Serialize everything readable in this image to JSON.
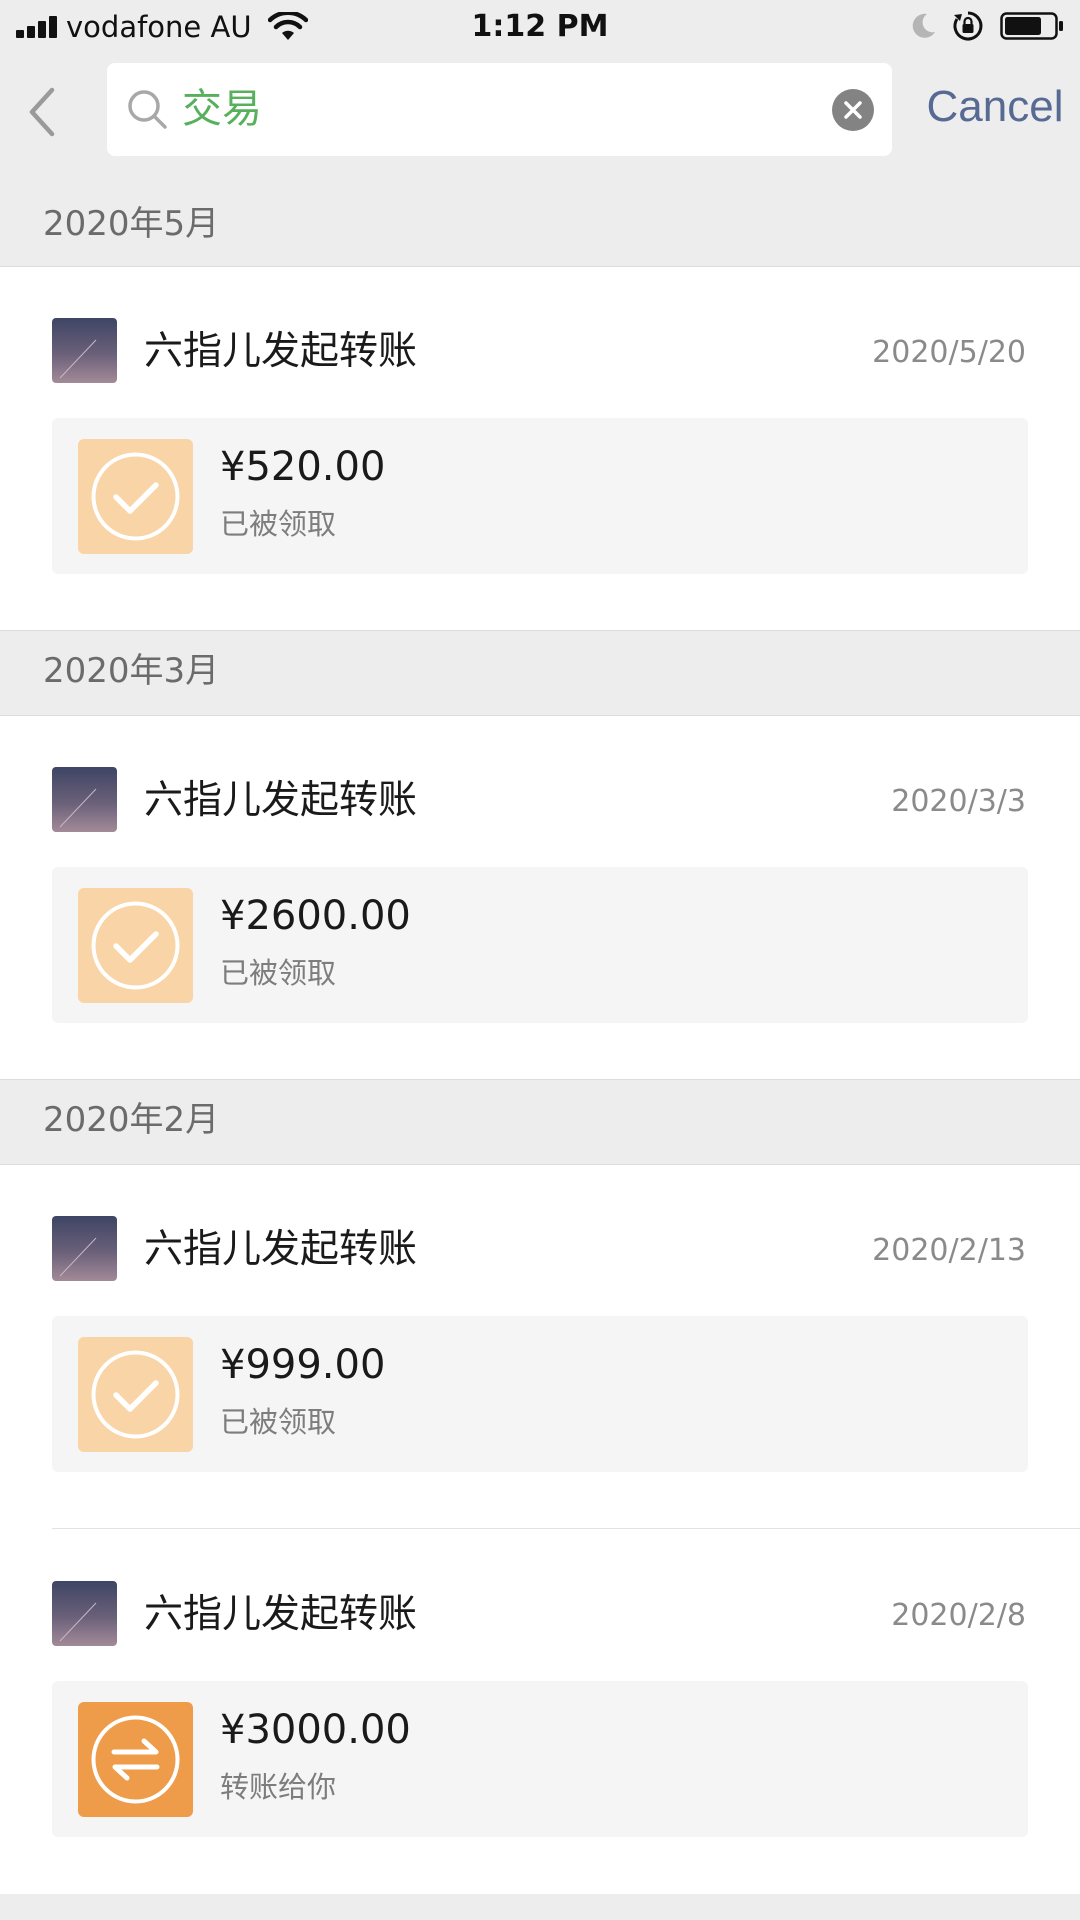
{
  "status_bar": {
    "carrier": "vodafone AU",
    "time": "1:12 PM",
    "signal_icon": "signal-bars-icon",
    "wifi_icon": "wifi-icon",
    "moon_icon": "do-not-disturb-moon-icon",
    "lock_icon": "orientation-lock-icon",
    "battery_icon": "battery-icon",
    "battery_level": 0.75
  },
  "search": {
    "back_icon": "chevron-left-icon",
    "search_icon": "search-icon",
    "query": "交易",
    "clear_icon": "clear-circle-icon",
    "cancel_label": "Cancel"
  },
  "sections": [
    {
      "month": "2020年5月",
      "entries": [
        {
          "title": "六指儿发起转账",
          "date": "2020/5/20",
          "amount": "¥520.00",
          "status": "已被领取",
          "icon": "check-circle-icon",
          "icon_color": "#f8d4a6"
        }
      ]
    },
    {
      "month": "2020年3月",
      "entries": [
        {
          "title": "六指儿发起转账",
          "date": "2020/3/3",
          "amount": "¥2600.00",
          "status": "已被领取",
          "icon": "check-circle-icon",
          "icon_color": "#f8d4a6"
        }
      ]
    },
    {
      "month": "2020年2月",
      "entries": [
        {
          "title": "六指儿发起转账",
          "date": "2020/2/13",
          "amount": "¥999.00",
          "status": "已被领取",
          "icon": "check-circle-icon",
          "icon_color": "#f8d4a6"
        },
        {
          "title": "六指儿发起转账",
          "date": "2020/2/8",
          "amount": "¥3000.00",
          "status": "转账给你",
          "icon": "transfer-arrows-icon",
          "icon_color": "#ee9b4a"
        }
      ]
    }
  ],
  "colors": {
    "background_gray": "#ededed",
    "search_text_green": "#57b05c",
    "cancel_blue": "#566a94",
    "received_orange_light": "#f8d4a6",
    "transfer_orange": "#ee9b4a"
  }
}
